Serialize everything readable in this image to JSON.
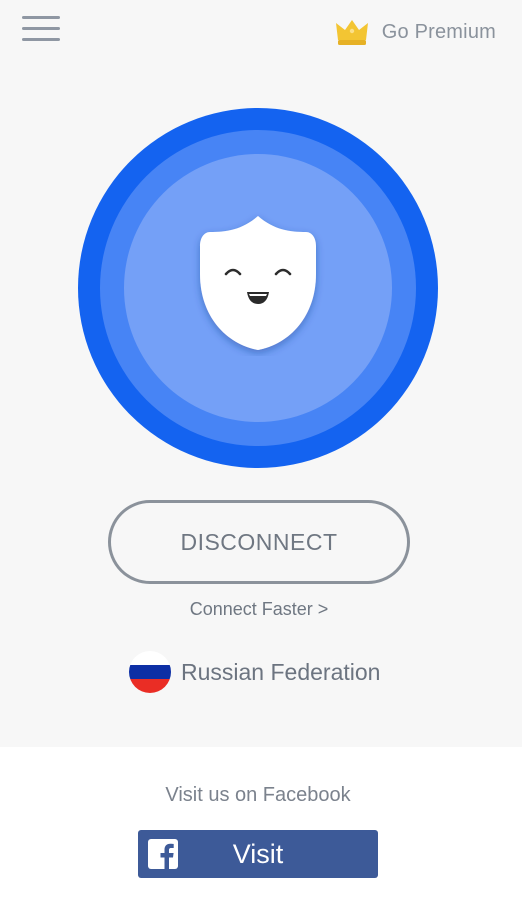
{
  "header": {
    "menu_icon": "hamburger-menu-icon",
    "premium_icon": "crown-icon",
    "premium_label": "Go Premium"
  },
  "status": {
    "mascot_icon": "smiling-shield-icon",
    "disconnect_label": "DISCONNECT",
    "connect_faster_label": "Connect Faster >"
  },
  "location": {
    "flag_icon": "russia-flag-icon",
    "name": "Russian Federation"
  },
  "footer": {
    "facebook_text": "Visit us on Facebook",
    "facebook_icon": "facebook-logo-icon",
    "visit_label": "Visit"
  },
  "colors": {
    "ring_outer": "#1463f0",
    "ring_middle": "#4784f5",
    "ring_inner": "#74a0f7",
    "facebook_blue": "#3d5a98",
    "crown_gold": "#f3c533"
  }
}
